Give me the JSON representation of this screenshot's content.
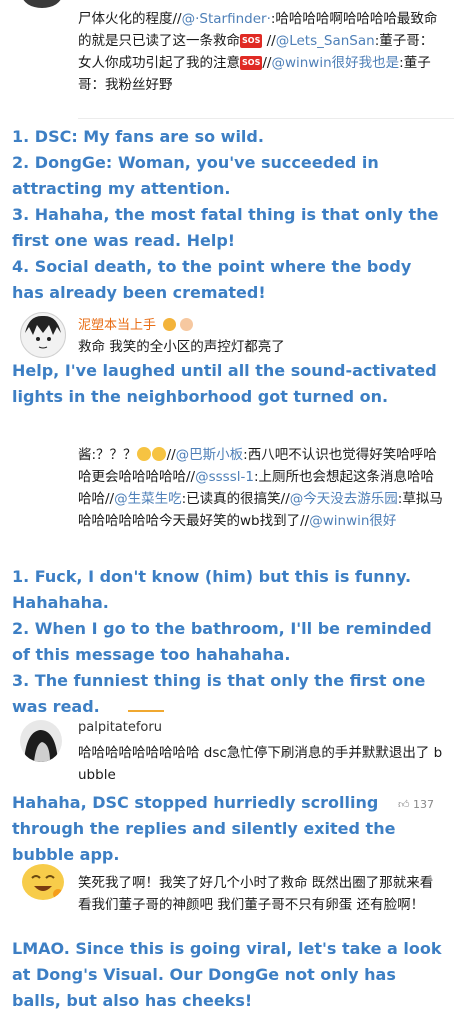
{
  "top_comment": {
    "line1_a": "尸体火化的程度//",
    "m1": "@·Starfinder·",
    "line1_b": ":哈哈哈哈啊",
    "line2": "哈哈哈哈最致命的就是只已读了这一条救命",
    "sos": "SOS",
    "line2_end": " //",
    "m2": "@Lets_SanSan",
    "line3_b": ":董子哥：女人你成功引起了我的",
    "line4_a": "注意",
    "line4_b": "//",
    "m3": "@winwin很好我也是",
    "line4_c": ":董子哥：我粉丝",
    "line5": "好野"
  },
  "top_translation": [
    "1. DSC: My fans are so wild.",
    "2. DongGe: Woman, you've succeeded in attracting my attention.",
    "3. Hahaha, the most fatal thing is that only the first one was read. Help!",
    "4. Social death, to the point where the body has already been cremated!"
  ],
  "comment2": {
    "username": "泥塑本当上手",
    "text": "救命 我笑的全小区的声控灯都亮了",
    "translation": "Help, I've laughed until all the sound-activated lights in the neighborhood got turned on."
  },
  "comment3": {
    "a": "酱:？？？",
    "b": "//",
    "m1": "@巴斯小板",
    "c": ":西八吧不认识也觉得好笑哈呼哈哈更会哈哈哈哈哈//",
    "m2": "@ssssl-1",
    "d": ":上厕所也会想起这条消息哈哈哈哈//",
    "m3": "@生菜生吃",
    "e": ":已读真的很搞笑//",
    "m4": "@今天没去游乐园",
    "f": ":草拟马哈哈哈哈哈哈今天最好笑的wb找到了//",
    "m5": "@winwin很好",
    "translation": [
      "1. Fuck, I don't know (him) but this is funny. Hahahaha.",
      "2. When I go to the bathroom, I'll be reminded of this message too hahahaha.",
      "3. The funniest thing is that only the first one was read."
    ]
  },
  "comment4": {
    "username": "palpitateforu",
    "text": "哈哈哈哈哈哈哈哈哈 dsc急忙停下刷消息的手并默默退出了 bubble",
    "like_count": "137",
    "translation": "Hahaha, DSC stopped hurriedly scrolling through the replies and silently exited the bubble app."
  },
  "comment5": {
    "text": "笑死我了啊！我笑了好几个小时了救命 既然出圈了那就来看看我们董子哥的神颜吧 我们董子哥不只有卵蛋 还有脸啊！",
    "translation": "LMAO. Since this is going viral, let's take a look at Dong's Visual. Our DongGe not only has balls, but also has cheeks!"
  }
}
